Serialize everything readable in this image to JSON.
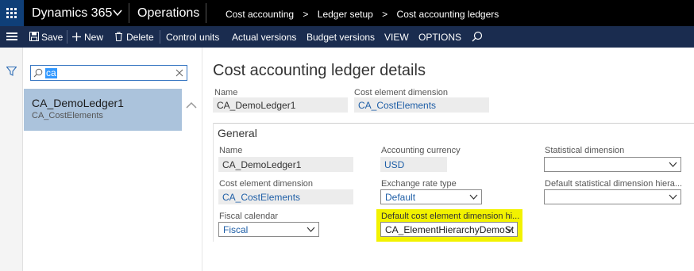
{
  "topbar": {
    "brand": "Dynamics 365",
    "module": "Operations",
    "breadcrumb": [
      "Cost accounting",
      "Ledger setup",
      "Cost accounting ledgers"
    ],
    "breadcrumb_sep": ">"
  },
  "actions": {
    "save": "Save",
    "new": "New",
    "delete": "Delete",
    "control_units": "Control units",
    "actual_versions": "Actual versions",
    "budget_versions": "Budget versions",
    "view": "VIEW",
    "options": "OPTIONS"
  },
  "list": {
    "search_value": "ca",
    "items": [
      {
        "title": "CA_DemoLedger1",
        "subtitle": "CA_CostElements"
      }
    ]
  },
  "details": {
    "title": "Cost accounting ledger details",
    "header": {
      "name_label": "Name",
      "name_value": "CA_DemoLedger1",
      "ced_label": "Cost element dimension",
      "ced_value": "CA_CostElements"
    },
    "general": {
      "section_title": "General",
      "name_label": "Name",
      "name_value": "CA_DemoLedger1",
      "ced_label": "Cost element dimension",
      "ced_value": "CA_CostElements",
      "fiscal_label": "Fiscal calendar",
      "fiscal_value": "Fiscal",
      "currency_label": "Accounting currency",
      "currency_value": "USD",
      "rate_label": "Exchange rate type",
      "rate_value": "Default",
      "hier_label": "Default cost element dimension hi...",
      "hier_value": "CA_ElementHierarchyDemoSt",
      "stat_label": "Statistical dimension",
      "stat_value": "",
      "stat_hier_label": "Default statistical dimension hiera...",
      "stat_hier_value": ""
    }
  },
  "colors": {
    "topbar": "#000000",
    "waffle": "#0f3f78",
    "actionbar": "#1a2c4f",
    "selected_row": "#abc3dc",
    "highlight": "#f2f200",
    "link": "#1f5fa7"
  },
  "icons": [
    "app-launcher-icon",
    "chevron-down-icon",
    "hamburger-icon",
    "save-icon",
    "plus-icon",
    "trash-icon",
    "search-icon",
    "filter-icon",
    "clear-icon",
    "scroll-up-icon"
  ]
}
